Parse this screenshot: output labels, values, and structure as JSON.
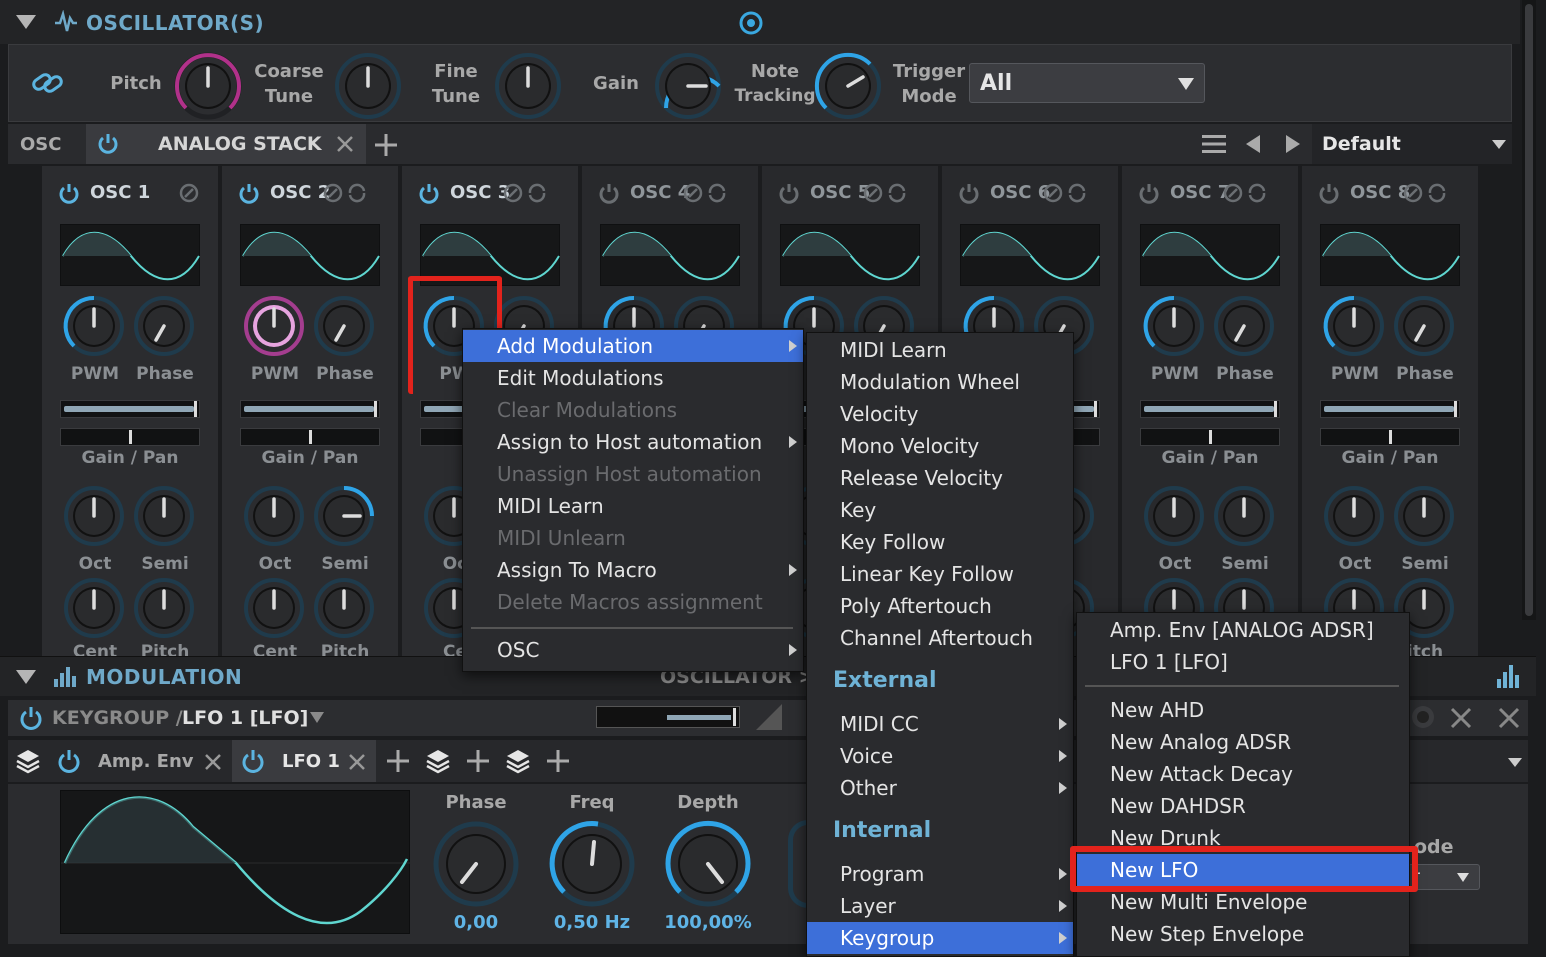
{
  "oscillators_panel": {
    "title": "OSCILLATOR(S)",
    "global_controls": {
      "pitch_label": "Pitch",
      "coarse_tune_label_1": "Coarse",
      "coarse_tune_label_2": "Tune",
      "fine_tune_label_1": "Fine",
      "fine_tune_label_2": "Tune",
      "gain_label": "Gain",
      "note_tracking_label_1": "Note",
      "note_tracking_label_2": "Tracking",
      "trigger_mode_label_1": "Trigger",
      "trigger_mode_label_2": "Mode",
      "trigger_mode_value": "All"
    },
    "tabbar": {
      "osc_label": "OSC",
      "active_tab": "ANALOG STACK",
      "preset": "Default"
    },
    "columns": [
      {
        "title": "OSC 1",
        "k1": "PWM",
        "k2": "Phase",
        "gp": "Gain / Pan",
        "k3": "Oct",
        "k4": "Semi",
        "k5": "Cent",
        "k6": "Pitch"
      },
      {
        "title": "OSC 2",
        "k1": "PWM",
        "k2": "Phase",
        "gp": "Gain / Pan",
        "k3": "Oct",
        "k4": "Semi",
        "k5": "Cent",
        "k6": "Pitch"
      },
      {
        "title": "OSC 3",
        "k1": "PW",
        "k2": "",
        "gp": "G",
        "k3": "Oc",
        "k4": "",
        "k5": "Ce",
        "k6": ""
      },
      {
        "title": "OSC 4",
        "k1": "",
        "k2": "",
        "gp": "",
        "k3": "",
        "k4": "",
        "k5": "",
        "k6": ""
      },
      {
        "title": "OSC 5",
        "k1": "",
        "k2": "se",
        "gp": "",
        "k3": "",
        "k4": "mi",
        "k5": "",
        "k6": ""
      },
      {
        "title": "OSC 6",
        "k1": "",
        "k2": "",
        "gp": "",
        "k3": "",
        "k4": "",
        "k5": "",
        "k6": ""
      },
      {
        "title": "OSC 7",
        "k1": "PWM",
        "k2": "Phase",
        "gp": "Gain / Pan",
        "k3": "Oct",
        "k4": "Semi",
        "k5": "",
        "k6": ""
      },
      {
        "title": "OSC 8",
        "k1": "PWM",
        "k2": "Phase",
        "gp": "Gain / Pan",
        "k3": "Oct",
        "k4": "Semi",
        "k5": "",
        "k6": "itch"
      }
    ]
  },
  "modulation_panel": {
    "title": "MODULATION",
    "breadcrumb_right": "OSCILLATOR >",
    "path_keygroup": "KEYGROUP /",
    "path_lfo": "LFO 1 [LFO]",
    "tabs": [
      "Amp. Env",
      "LFO 1"
    ],
    "lfo": {
      "phase_label": "Phase",
      "phase_value": "0,00",
      "freq_label": "Freq",
      "freq_value": "0,50 Hz",
      "depth_label": "Depth",
      "depth_value": "100,00%"
    },
    "mode_partial": "ode",
    "mode_value_partial": "r"
  },
  "context_menu": {
    "items": [
      {
        "label": "Add Modulation",
        "state": "highlighted",
        "submenu": true
      },
      {
        "label": "Edit Modulations",
        "state": "enabled",
        "submenu": false
      },
      {
        "label": "Clear Modulations",
        "state": "disabled",
        "submenu": false
      },
      {
        "label": "Assign to Host automation",
        "state": "enabled",
        "submenu": true
      },
      {
        "label": "Unassign Host automation",
        "state": "disabled",
        "submenu": false
      },
      {
        "label": "MIDI Learn",
        "state": "enabled",
        "submenu": false
      },
      {
        "label": "MIDI Unlearn",
        "state": "disabled",
        "submenu": false
      },
      {
        "label": "Assign To Macro",
        "state": "enabled",
        "submenu": true
      },
      {
        "label": "Delete Macros assignment",
        "state": "disabled",
        "submenu": false
      }
    ],
    "osc_item": "OSC"
  },
  "submenu_sources": {
    "items": [
      "MIDI Learn",
      "Modulation Wheel",
      "Velocity",
      "Mono Velocity",
      "Release Velocity",
      "Key",
      "Key Follow",
      "Linear Key Follow",
      "Poly Aftertouch",
      "Channel Aftertouch"
    ],
    "external_header": "External",
    "external_items": [
      "MIDI CC",
      "Voice",
      "Other"
    ],
    "internal_header": "Internal",
    "internal_items": [
      "Program",
      "Layer",
      "Keygroup"
    ]
  },
  "submenu_keygroup": {
    "existing": [
      "Amp. Env [ANALOG ADSR]",
      "LFO 1 [LFO]"
    ],
    "new_items": [
      "New AHD",
      "New Analog ADSR",
      "New Attack Decay",
      "New DAHDSR",
      "New Drunk",
      "New LFO",
      "New Multi Envelope",
      "New Step Envelope"
    ]
  },
  "colors": {
    "accent_blue": "#3d6fd9",
    "knob_ring": "#2fa4e7",
    "wave": "#5fd6d0",
    "highlight_red": "#e3231c",
    "title_blue": "#6fa9c9"
  }
}
